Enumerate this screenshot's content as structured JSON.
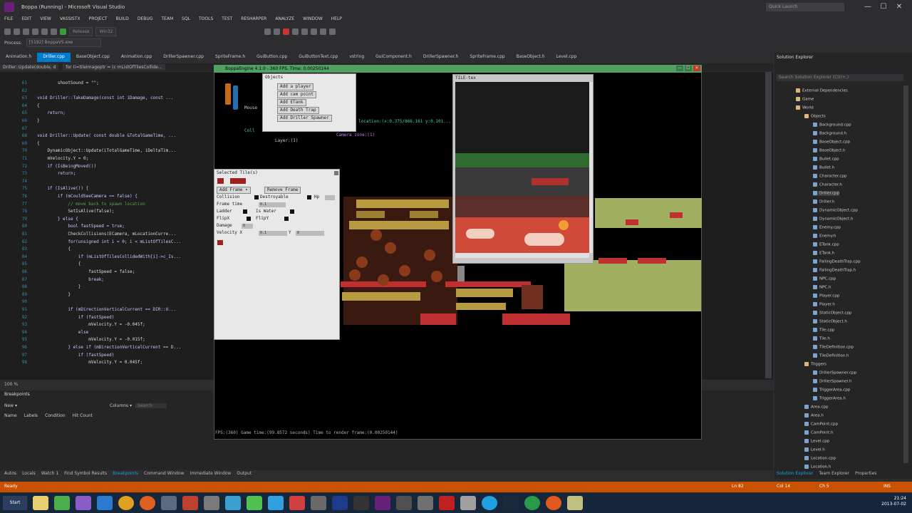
{
  "window": {
    "title": "Boppa (Running) - Microsoft Visual Studio",
    "quick_launch": "Quick Launch",
    "minimize": "—",
    "maximize": "☐",
    "close": "✕"
  },
  "menu": [
    "FILE",
    "EDIT",
    "VIEW",
    "VASSISTX",
    "PROJECT",
    "BUILD",
    "DEBUG",
    "TEAM",
    "SQL",
    "TOOLS",
    "TEST",
    "RESHARPER",
    "ANALYZE",
    "WINDOW",
    "HELP"
  ],
  "toolbar": {
    "config": "Release",
    "platform": "Win32",
    "process_label": "Process:",
    "process_value": "[5192] BoppaVS.exe"
  },
  "doc_tabs": [
    {
      "label": "Animation.h",
      "active": false
    },
    {
      "label": "Driller.cpp",
      "active": true
    },
    {
      "label": "BaseObject.cpp",
      "active": false
    },
    {
      "label": "Animation.cpp",
      "active": false
    },
    {
      "label": "DrillerSpawner.cpp",
      "active": false
    },
    {
      "label": "SpriteFrame.h",
      "active": false
    },
    {
      "label": "GuiButton.cpp",
      "active": false
    },
    {
      "label": "GuiButtonText.cpp",
      "active": false
    },
    {
      "label": "vstring",
      "active": false
    },
    {
      "label": "GuiComponent.h",
      "active": false
    },
    {
      "label": "DrillerSpawner.h",
      "active": false
    },
    {
      "label": "SpriteFrame.cpp",
      "active": false
    },
    {
      "label": "BaseObject.h",
      "active": false
    },
    {
      "label": "Level.cpp",
      "active": false
    }
  ],
  "nav": {
    "scope": "Driller::Update(double, d",
    "member": "for (i=tileImageptr = (c mListOfTilesCollide..."
  },
  "editor": {
    "lines": [
      {
        "n": "61",
        "text": "        shootSound = \"\";"
      },
      {
        "n": "62",
        "text": ""
      },
      {
        "n": "63",
        "text": "void Driller::TakeDamage(const int iDamage, const ..."
      },
      {
        "n": "64",
        "text": "{"
      },
      {
        "n": "65",
        "text": "    return;"
      },
      {
        "n": "66",
        "text": "}"
      },
      {
        "n": "67",
        "text": ""
      },
      {
        "n": "68",
        "text": "void Driller::Update( const double &TotalGameTime, ..."
      },
      {
        "n": "69",
        "text": "{"
      },
      {
        "n": "70",
        "text": "    DynamicObject::Update(iTotalGameTime, iDeltaTim..."
      },
      {
        "n": "71",
        "text": "    mVelocity.Y = 0;"
      },
      {
        "n": "72",
        "text": "    if (IsBeingMoved())"
      },
      {
        "n": "73",
        "text": "        return;"
      },
      {
        "n": "74",
        "text": ""
      },
      {
        "n": "75",
        "text": "    if (IsAlive()) {"
      },
      {
        "n": "76",
        "text": "        if (mCouldSeeCamera == false) {"
      },
      {
        "n": "77",
        "text": "            // move back to spawn location"
      },
      {
        "n": "78",
        "text": "            SetIsAlive(false);"
      },
      {
        "n": "79",
        "text": "        } else {"
      },
      {
        "n": "80",
        "text": "            bool fastSpeed = true;"
      },
      {
        "n": "81",
        "text": "            CheckCollisions(ECamera, mLocationCurre..."
      },
      {
        "n": "82",
        "text": "            for(unsigned int i = 0; i < mListOfTilesC..."
      },
      {
        "n": "83",
        "text": "            {"
      },
      {
        "n": "84",
        "text": "                if (mListOfTilesCollidedWith[i]->c_Is..."
      },
      {
        "n": "85",
        "text": "                {"
      },
      {
        "n": "86",
        "text": "                    fastSpeed = false;"
      },
      {
        "n": "87",
        "text": "                    break;"
      },
      {
        "n": "88",
        "text": "                }"
      },
      {
        "n": "89",
        "text": "            }"
      },
      {
        "n": "90",
        "text": ""
      },
      {
        "n": "91",
        "text": "            if (mDirectionVerticalCurrent == DIR::U..."
      },
      {
        "n": "92",
        "text": "                if (fastSpeed)"
      },
      {
        "n": "93",
        "text": "                    mVelocity.Y = -0.045f;"
      },
      {
        "n": "94",
        "text": "                else"
      },
      {
        "n": "95",
        "text": "                    mVelocity.Y = -0.015f;"
      },
      {
        "n": "96",
        "text": "            } else if (mDirectionVerticalCurrent == D..."
      },
      {
        "n": "97",
        "text": "                if (fastSpeed)"
      },
      {
        "n": "98",
        "text": "                    mVelocity.Y = 0.045f;"
      }
    ],
    "zoom": "100 %"
  },
  "breakpoints": {
    "title": "Breakpoints",
    "new": "New ▾",
    "columns_btn": "Columns ▾",
    "search": "Search",
    "cols": [
      "Name",
      "Labels",
      "Condition",
      "Hit Count"
    ]
  },
  "bottom_tabs": [
    {
      "label": "Autos",
      "active": false
    },
    {
      "label": "Locals",
      "active": false
    },
    {
      "label": "Watch 1",
      "active": false
    },
    {
      "label": "Find Symbol Results",
      "active": false
    },
    {
      "label": "Breakpoints",
      "active": true
    },
    {
      "label": "Command Window",
      "active": false
    },
    {
      "label": "Immediate Window",
      "active": false
    },
    {
      "label": "Output",
      "active": false
    }
  ],
  "solution": {
    "title": "Solution Explorer",
    "search": "Search Solution Explorer (Ctrl+;)",
    "items": [
      {
        "label": "External Dependencies",
        "indent": 1
      },
      {
        "label": "Game",
        "indent": 1
      },
      {
        "label": "World",
        "indent": 1
      },
      {
        "label": "Objects",
        "indent": 2
      },
      {
        "label": "Background.cpp",
        "indent": 3
      },
      {
        "label": "Background.h",
        "indent": 3
      },
      {
        "label": "BaseObject.cpp",
        "indent": 3
      },
      {
        "label": "BaseObject.h",
        "indent": 3
      },
      {
        "label": "Bullet.cpp",
        "indent": 3
      },
      {
        "label": "Bullet.h",
        "indent": 3
      },
      {
        "label": "Character.cpp",
        "indent": 3
      },
      {
        "label": "Character.h",
        "indent": 3
      },
      {
        "label": "Driller.cpp",
        "indent": 3,
        "selected": true
      },
      {
        "label": "Driller.h",
        "indent": 3
      },
      {
        "label": "DynamicObject.cpp",
        "indent": 3
      },
      {
        "label": "DynamicObject.h",
        "indent": 3
      },
      {
        "label": "Enemy.cpp",
        "indent": 3
      },
      {
        "label": "Enemy.h",
        "indent": 3
      },
      {
        "label": "ETank.cpp",
        "indent": 3
      },
      {
        "label": "ETank.h",
        "indent": 3
      },
      {
        "label": "FallingDeathTrap.cpp",
        "indent": 3
      },
      {
        "label": "FallingDeathTrap.h",
        "indent": 3
      },
      {
        "label": "NPC.cpp",
        "indent": 3
      },
      {
        "label": "NPC.h",
        "indent": 3
      },
      {
        "label": "Player.cpp",
        "indent": 3
      },
      {
        "label": "Player.h",
        "indent": 3
      },
      {
        "label": "StaticObject.cpp",
        "indent": 3
      },
      {
        "label": "StaticObject.h",
        "indent": 3
      },
      {
        "label": "Tile.cpp",
        "indent": 3
      },
      {
        "label": "Tile.h",
        "indent": 3
      },
      {
        "label": "TileDefinition.cpp",
        "indent": 3
      },
      {
        "label": "TileDefinition.h",
        "indent": 3
      },
      {
        "label": "Triggers",
        "indent": 2
      },
      {
        "label": "DrillerSpawner.cpp",
        "indent": 3
      },
      {
        "label": "DrillerSpawner.h",
        "indent": 3
      },
      {
        "label": "TriggerArea.cpp",
        "indent": 3
      },
      {
        "label": "TriggerArea.h",
        "indent": 3
      },
      {
        "label": "Area.cpp",
        "indent": 2
      },
      {
        "label": "Area.h",
        "indent": 2
      },
      {
        "label": "CamPoint.cpp",
        "indent": 2
      },
      {
        "label": "CamPoint.h",
        "indent": 2
      },
      {
        "label": "Level.cpp",
        "indent": 2
      },
      {
        "label": "Level.h",
        "indent": 2
      },
      {
        "label": "Location.cpp",
        "indent": 2
      },
      {
        "label": "Location.h",
        "indent": 2
      }
    ],
    "tabs": [
      "Solution Explorer",
      "Team Explorer",
      "Properties"
    ]
  },
  "status": {
    "left": "Ready",
    "ln": "Ln 82",
    "col": "Col 14",
    "ch": "Ch 5",
    "ins": "INS"
  },
  "taskbar": {
    "start": "Start",
    "time": "21:24",
    "date": "2013-07-02"
  },
  "game": {
    "title": "BoppaEngine 4.1.0 - 360 FPS. Time: 0.00250144",
    "objects_panel": {
      "title": "Objects",
      "buttons": [
        "Add a player",
        "Add cam point",
        "Add ETank",
        "Add Death Trap",
        "Add Driller Spawner"
      ]
    },
    "overlay_mouse": "Mouse",
    "overlay_layer": "Layer:(1)",
    "overlay_loc": "location:(x:0.375/866.161 y:0.101...",
    "overlay_cam": "Camera zone:(1)",
    "overlay_coll": "Coll",
    "tile_panel": {
      "title": "Selected Tile(s)",
      "add_frame": "Add Frame ▾",
      "remove_frame": "Remove Frame",
      "collision": "Collision",
      "destroyable": "Destroyable",
      "hp": "Hp",
      "frame_time": "Frame time",
      "frame_time_val": "0.1",
      "ladder": "Ladder",
      "is_water": "Is Water",
      "flipx": "FlipX",
      "flipy": "FlipY",
      "damage": "Damage",
      "damage_val": "0",
      "velocity": "Velocity X",
      "vel_x": "0.1",
      "vel_y_label": "Y",
      "vel_y": "0"
    },
    "tileset_title": "TILE-tex",
    "bottom_status": "FPS:(360) Game time:(99.8572 seconds) Time to render frame:(0.00250144)"
  },
  "colors": {
    "accent": "#007acc",
    "status": "#ca5100",
    "taskbar": "#16263b"
  }
}
